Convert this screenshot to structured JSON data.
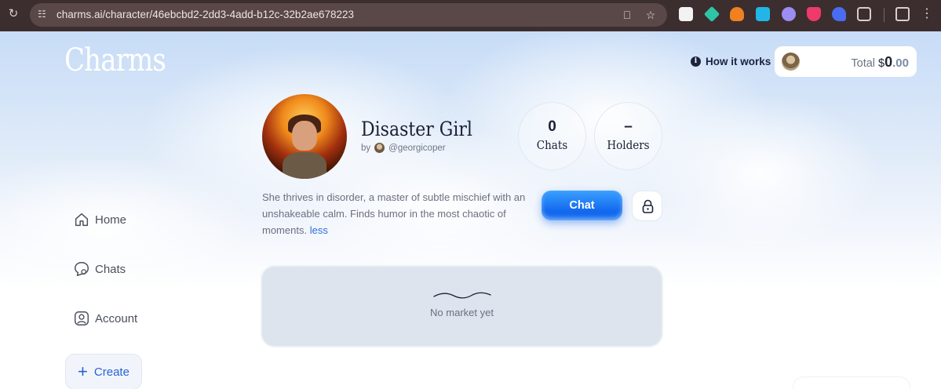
{
  "browser": {
    "url": "charms.ai/character/46ebcbd2-2dd3-4add-b12c-32b2ae678223"
  },
  "header": {
    "logo": "Charms",
    "how_it_works": "How it works",
    "wallet": {
      "total_label": "Total",
      "currency": "$",
      "amount_int": "0",
      "amount_dec": ".00"
    }
  },
  "sidebar": {
    "items": [
      {
        "label": "Home",
        "icon": "home-icon"
      },
      {
        "label": "Chats",
        "icon": "chat-bubbles-icon"
      },
      {
        "label": "Account",
        "icon": "account-icon"
      }
    ],
    "create_label": "Create"
  },
  "character": {
    "name": "Disaster Girl",
    "by_label": "by",
    "creator": "@georgicoper",
    "chats_count": "0",
    "chats_label": "Chats",
    "holders_count": "–",
    "holders_label": "Holders",
    "description": "She thrives in disorder, a master of subtle mischief with an unshakeable calm. Finds humor in the most chaotic of moments.",
    "less_label": "less",
    "chat_button": "Chat"
  },
  "market": {
    "empty_text": "No market yet"
  },
  "colors": {
    "accent": "#1268ee",
    "text_dark": "#1a2035",
    "link": "#2f6fd8"
  }
}
